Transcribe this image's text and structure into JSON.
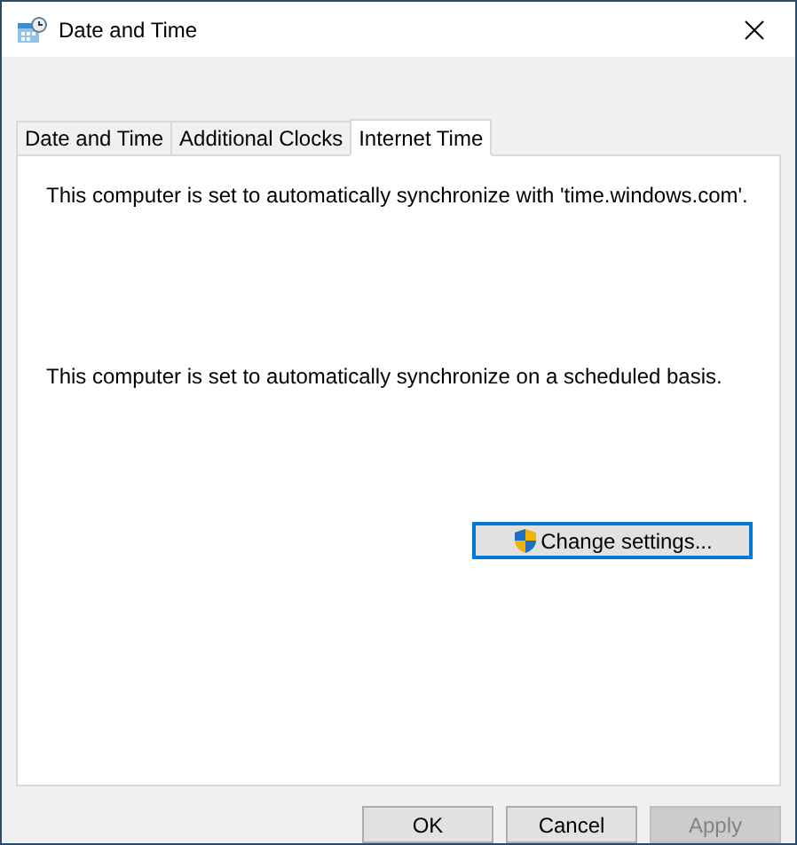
{
  "window": {
    "title": "Date and Time"
  },
  "tabs": [
    {
      "label": "Date and Time",
      "selected": false
    },
    {
      "label": "Additional Clocks",
      "selected": false
    },
    {
      "label": "Internet Time",
      "selected": true
    }
  ],
  "panel": {
    "server_text": "This computer is set to automatically synchronize with 'time.windows.com'.",
    "schedule_text": "This computer is set to automatically synchronize on a scheduled basis.",
    "change_button": "Change settings..."
  },
  "buttons": [
    {
      "label": "OK",
      "disabled": false
    },
    {
      "label": "Cancel",
      "disabled": false
    },
    {
      "label": "Apply",
      "disabled": true
    }
  ]
}
